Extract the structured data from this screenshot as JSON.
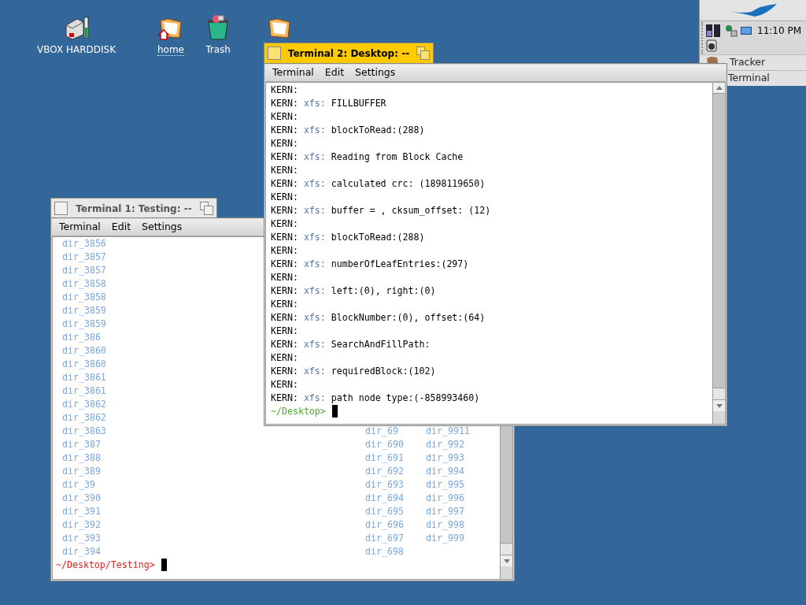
{
  "desktop_icons": [
    {
      "kind": "disk",
      "label": "VBOX HARDDISK",
      "link": false
    },
    {
      "kind": "home",
      "label": "home",
      "link": true
    },
    {
      "kind": "trash",
      "label": "Trash",
      "link": false
    },
    {
      "kind": "folder"
    }
  ],
  "deskbar": {
    "clock": "11:10 PM",
    "apps": [
      {
        "kind": "tracker",
        "label": "Tracker"
      },
      {
        "kind": "terminal",
        "label": "Terminal"
      }
    ]
  },
  "windows": [
    {
      "kind": "listing",
      "title": "Terminal 1: Testing: --",
      "focused": false,
      "menu": [
        "Terminal",
        "Edit",
        "Settings"
      ],
      "rows": [
        {
          "column_1": "dir_3856"
        },
        {
          "column_1": "dir_3857"
        },
        {
          "column_1": "dir_3857"
        },
        {
          "column_1": "dir_3858"
        },
        {
          "column_1": "dir_3858"
        },
        {
          "column_1": "dir_3859"
        },
        {
          "column_1": "dir_3859"
        },
        {
          "column_1": "dir_386"
        },
        {
          "column_1": "dir_3860"
        },
        {
          "column_1": "dir_3860"
        },
        {
          "column_1": "dir_3861"
        },
        {
          "column_1": "dir_3861"
        },
        {
          "column_1": "dir_3862"
        },
        {
          "column_1": "dir_3862"
        },
        {
          "column_1": "dir_3863",
          "column_2": "dir_69",
          "column_3": "dir_9911"
        },
        {
          "column_1": "dir_387",
          "column_2": "dir_690",
          "column_3": "dir_992"
        },
        {
          "column_1": "dir_388",
          "column_2": "dir_691",
          "column_3": "dir_993"
        },
        {
          "column_1": "dir_389",
          "column_2": "dir_692",
          "column_3": "dir_994"
        },
        {
          "column_1": "dir_39",
          "column_2": "dir_693",
          "column_3": "dir_995"
        },
        {
          "column_1": "dir_390",
          "column_2": "dir_694",
          "column_3": "dir_996"
        },
        {
          "column_1": "dir_391",
          "column_2": "dir_695",
          "column_3": "dir_997"
        },
        {
          "column_1": "dir_392",
          "column_2": "dir_696",
          "column_3": "dir_998"
        },
        {
          "column_1": "dir_393",
          "column_2": "dir_697",
          "column_3": "dir_999"
        },
        {
          "column_1": "dir_394",
          "column_2": "dir_698"
        }
      ],
      "prompt": "~/Desktop/Testing>"
    },
    {
      "kind": "log",
      "title": "Terminal 2: Desktop: --",
      "focused": true,
      "menu": [
        "Terminal",
        "Edit",
        "Settings"
      ],
      "rows": [
        {
          "source": "KERN:"
        },
        {
          "source": "KERN:",
          "tag": "xfs:",
          "message": "FILLBUFFER"
        },
        {
          "source": "KERN:"
        },
        {
          "source": "KERN:",
          "tag": "xfs:",
          "message": "blockToRead:(288)"
        },
        {
          "source": "KERN:"
        },
        {
          "source": "KERN:",
          "tag": "xfs:",
          "message": "Reading from Block Cache"
        },
        {
          "source": "KERN:"
        },
        {
          "source": "KERN:",
          "tag": "xfs:",
          "message": "calculated crc: (1898119650)"
        },
        {
          "source": "KERN:"
        },
        {
          "source": "KERN:",
          "tag": "xfs:",
          "message": "buffer = , cksum_offset: (12)"
        },
        {
          "source": "KERN:"
        },
        {
          "source": "KERN:",
          "tag": "xfs:",
          "message": "blockToRead:(288)"
        },
        {
          "source": "KERN:"
        },
        {
          "source": "KERN:",
          "tag": "xfs:",
          "message": "numberOfLeafEntries:(297)"
        },
        {
          "source": "KERN:"
        },
        {
          "source": "KERN:",
          "tag": "xfs:",
          "message": "left:(0), right:(0)"
        },
        {
          "source": "KERN:"
        },
        {
          "source": "KERN:",
          "tag": "xfs:",
          "message": "BlockNumber:(0), offset:(64)"
        },
        {
          "source": "KERN:"
        },
        {
          "source": "KERN:",
          "tag": "xfs:",
          "message": "SearchAndFillPath:"
        },
        {
          "source": "KERN:"
        },
        {
          "source": "KERN:",
          "tag": "xfs:",
          "message": "requiredBlock:(102)"
        },
        {
          "source": "KERN:"
        },
        {
          "source": "KERN:",
          "tag": "xfs:",
          "message": "path node type:(-858993460)"
        }
      ],
      "prompt": "~/Desktop>"
    }
  ]
}
